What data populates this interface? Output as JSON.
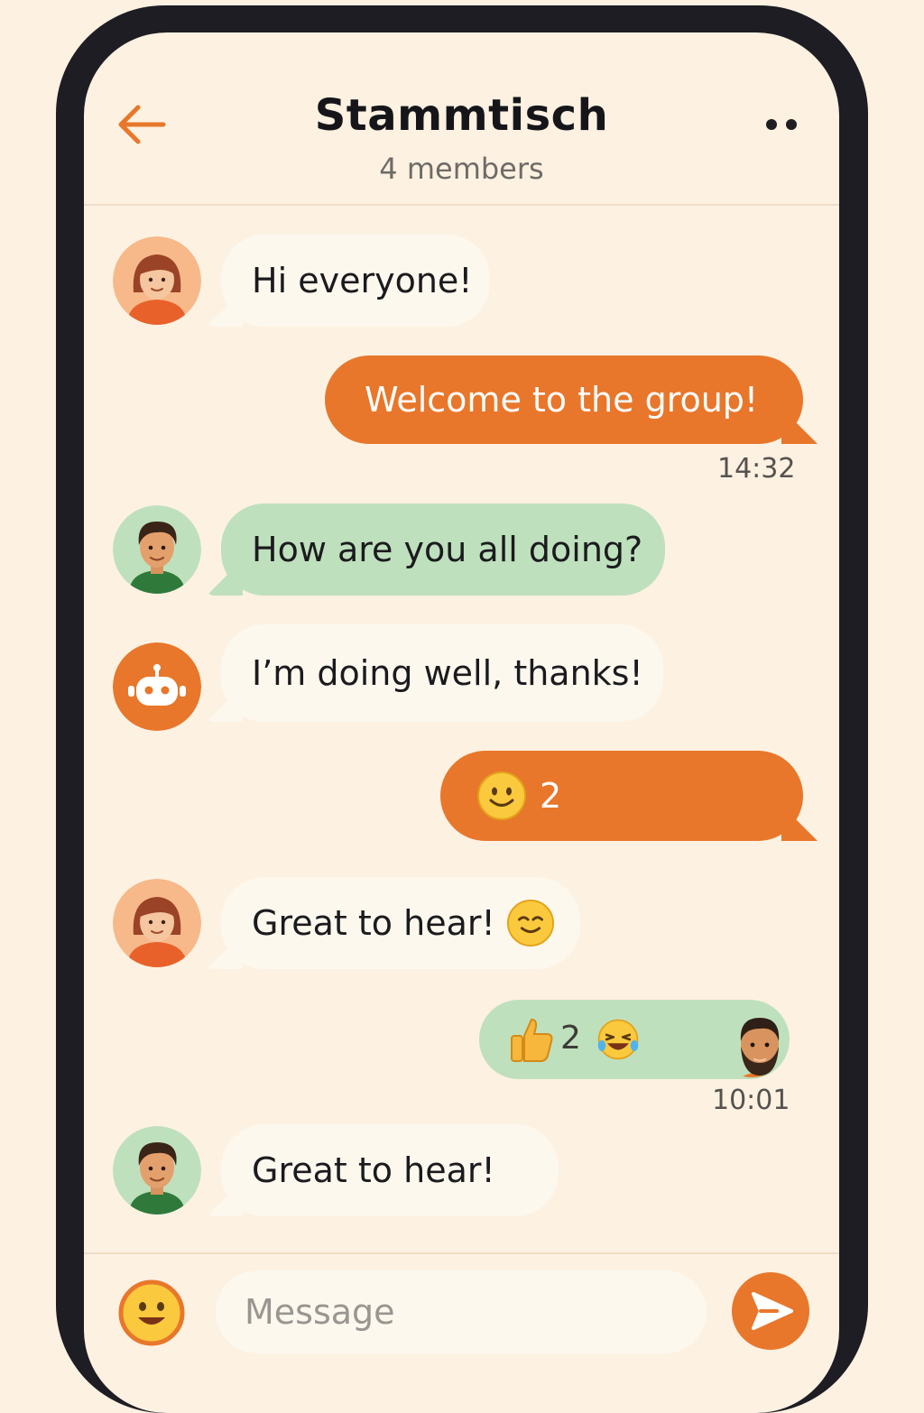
{
  "header": {
    "title": "Stammtisch",
    "subtitle": "4 members",
    "back_icon": "arrow-left-icon",
    "menu_icon": "more-dots-icon"
  },
  "colors": {
    "accent": "#e8772b",
    "incoming_bubble": "#fdf8ee",
    "green_bubble": "#bfe0bd",
    "background": "#fdf1e2"
  },
  "messages": [
    {
      "sender": "woman-avatar",
      "text": "Hi everyone!"
    },
    {
      "sender": "self",
      "text": "Welcome to the group!",
      "time": "14:32"
    },
    {
      "sender": "man-avatar",
      "text": "How are you all doing?"
    },
    {
      "sender": "bot-avatar",
      "text": "I’m doing well, thanks!"
    },
    {
      "sender": "self",
      "emoji": "smiley-emoji",
      "count": "2"
    },
    {
      "sender": "woman-avatar",
      "text": "Great to hear!",
      "emoji": "smile-emoji"
    },
    {
      "sender": "self",
      "reactions": [
        {
          "emoji": "thumbs-up-emoji",
          "count": "2"
        },
        {
          "emoji": "laughing-emoji"
        }
      ],
      "reactor": "bearded-man-avatar",
      "time": "10:01"
    },
    {
      "sender": "man-avatar",
      "text": "Great to hear!"
    }
  ],
  "composer": {
    "placeholder": "Message",
    "emoji_icon": "smiley-icon",
    "send_icon": "send-icon"
  }
}
